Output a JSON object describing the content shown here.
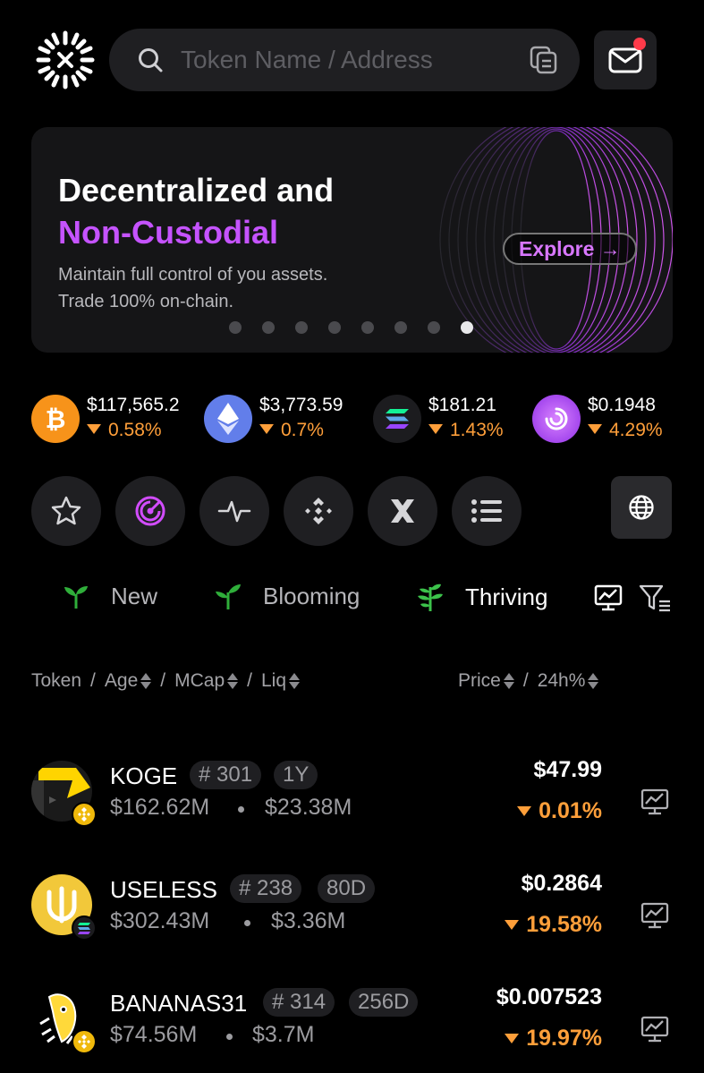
{
  "header": {
    "search_placeholder": "Token Name / Address"
  },
  "banner": {
    "title_line1": "Decentralized and",
    "title_line2": "Non-Custodial",
    "subtitle_line1": "Maintain full control of you assets.",
    "subtitle_line2": "Trade 100% on-chain.",
    "cta_label": "Explore →",
    "page_count": 8,
    "active_page": 8
  },
  "tickers": [
    {
      "symbol": "bitcoin-icon",
      "price": "$117,565.2",
      "change": "0.58%",
      "color": "#f7931a"
    },
    {
      "symbol": "ethereum-icon",
      "price": "$3,773.59",
      "change": "0.7%",
      "color": "#627eea"
    },
    {
      "symbol": "solana-icon",
      "price": "$181.21",
      "change": "1.43%",
      "color": "#1c1c1f"
    },
    {
      "symbol": "pump-icon",
      "price": "$0.1948",
      "change": "4.29%",
      "color": "#b44cff"
    }
  ],
  "filters": [
    "star-icon",
    "radar-icon",
    "pulse-icon",
    "binance-icon",
    "x-icon",
    "list-icon"
  ],
  "tabs": [
    {
      "label": "New"
    },
    {
      "label": "Blooming"
    },
    {
      "label": "Thriving"
    }
  ],
  "columns": {
    "token": "Token",
    "age": "Age",
    "mcap": "MCap",
    "liq": "Liq",
    "price": "Price",
    "change": "24h%",
    "slash": "/"
  },
  "tokens": [
    {
      "name": "KOGE",
      "rank": "# 301",
      "age": "1Y",
      "mcap": "$162.62M",
      "liq": "$23.38M",
      "price": "$47.99",
      "change": "0.01%",
      "chain": "bnb"
    },
    {
      "name": "USELESS",
      "rank": "# 238",
      "age": "80D",
      "mcap": "$302.43M",
      "liq": "$3.36M",
      "price": "$0.2864",
      "change": "19.58%",
      "chain": "solana"
    },
    {
      "name": "BANANAS31",
      "rank": "# 314",
      "age": "256D",
      "mcap": "$74.56M",
      "liq": "$3.7M",
      "price": "$0.007523",
      "change": "19.97%",
      "chain": "bnb"
    }
  ],
  "colors": {
    "accent_purple": "#c553ff",
    "down_orange": "#ff9f3a",
    "surface": "#1f1f22"
  }
}
